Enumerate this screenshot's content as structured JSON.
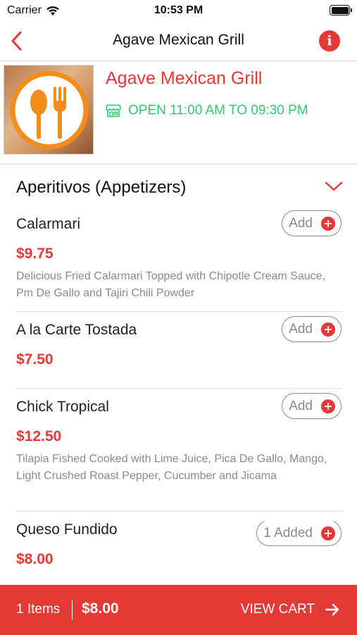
{
  "status_bar": {
    "carrier": "Carrier",
    "time": "10:53 PM"
  },
  "nav": {
    "title": "Agave Mexican Grill"
  },
  "restaurant": {
    "name": "Agave Mexican Grill",
    "hours": "OPEN 11:00 AM TO 09:30 PM"
  },
  "menu": {
    "category": "Aperitivos (Appetizers)",
    "items": [
      {
        "name": "Calarmari",
        "price": "$9.75",
        "description": "Delicious Fried Calarmari Topped with Chipotle Cream Sauce, Pm De Gallo and Tajiri Chili Powder",
        "button": "Add"
      },
      {
        "name": "A la Carte Tostada",
        "price": "$7.50",
        "description": "",
        "button": "Add"
      },
      {
        "name": "Chick Tropical",
        "price": "$12.50",
        "description": "Tilapia Fished Cooked with Lime Juice, Pica De Gallo, Mango, Light Crushed Roast Pepper, Cucumber and Jicama",
        "button": "Add"
      },
      {
        "name": "Queso Fundido",
        "price": "$8.00",
        "description": "",
        "button": "1 Added"
      }
    ]
  },
  "cart": {
    "items": "1 Items",
    "total": "$8.00",
    "view_label": "VIEW CART"
  },
  "colors": {
    "accent": "#e53935",
    "open_status": "#2ecc71",
    "muted": "#8a8a8a",
    "logo_ring": "#f28c1b"
  },
  "icons": [
    "wifi-icon",
    "battery-icon",
    "back-arrow-icon",
    "info-icon",
    "restaurant-logo",
    "store-icon",
    "chevron-down-icon",
    "plus-icon",
    "arrow-right-icon"
  ]
}
